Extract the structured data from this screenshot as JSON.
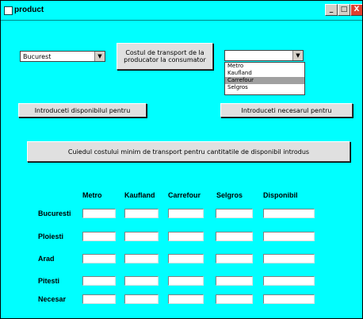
{
  "window": {
    "title": "product",
    "minimize_label": "_",
    "maximize_label": "□",
    "close_label": "X"
  },
  "left_combo": {
    "value": "Bucurest",
    "arrow": "▼"
  },
  "cost_button": {
    "label": "Costul de transport de la producator la consumator"
  },
  "right_combo": {
    "value": "",
    "arrow": "▼",
    "options": [
      "Metro",
      "Kaufland",
      "Carrefour",
      "Selgros"
    ],
    "selected_index": 2
  },
  "buttons": {
    "available": "Introduceti disponibilul pentru",
    "required": "Introduceti necesarul pentru",
    "table_title": "Cuiedul costului minim de transport pentru cantitatile de disponibil introdus"
  },
  "table": {
    "columns": [
      "Metro",
      "Kaufland",
      "Carrefour",
      "Selgros",
      "Disponibil"
    ],
    "rows": [
      "Bucuresti",
      "Ploiesti",
      "Arad",
      "Pitesti",
      "Necesar"
    ]
  }
}
